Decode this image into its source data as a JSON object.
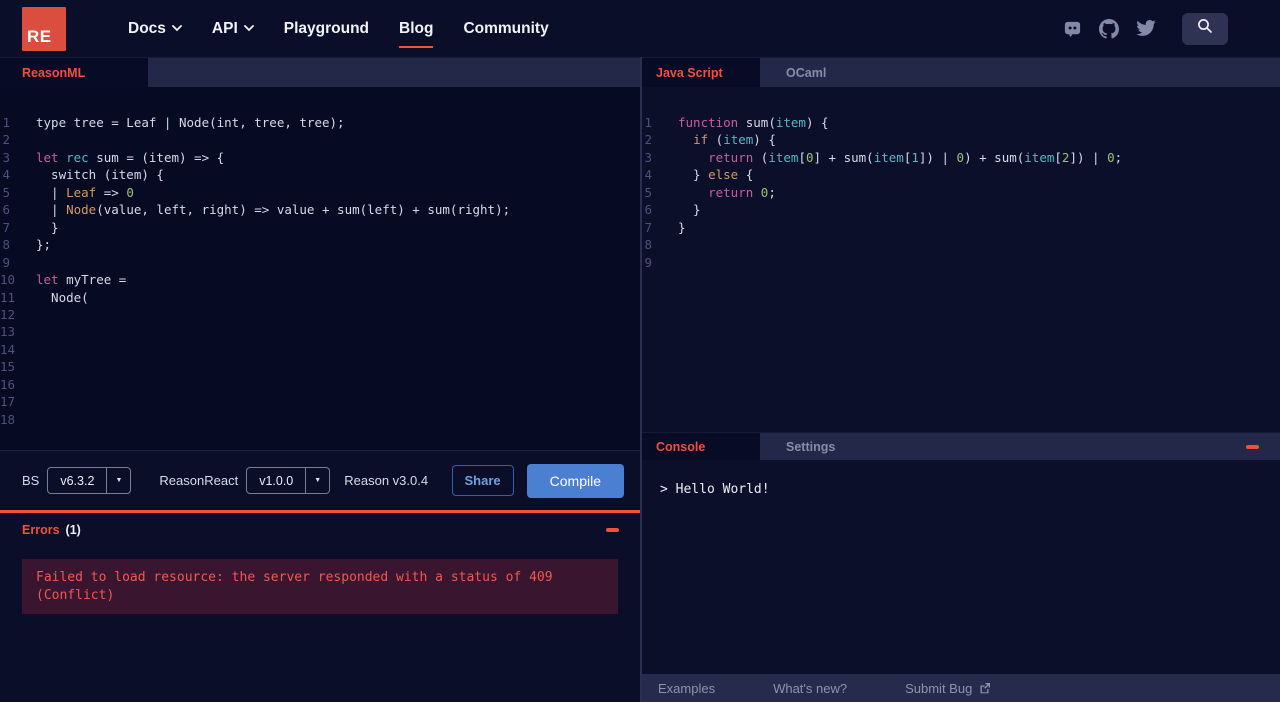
{
  "nav": {
    "logo_text": "RE",
    "items": [
      {
        "label": "Docs"
      },
      {
        "label": "API"
      },
      {
        "label": "Playground"
      },
      {
        "label": "Blog"
      },
      {
        "label": "Community"
      }
    ]
  },
  "left": {
    "tab_label": "ReasonML",
    "toolbar": {
      "bs_label": "BS",
      "bs_version": "v6.3.2",
      "reason_react_label": "ReasonReact",
      "reason_react_version": "v1.0.0",
      "reason_version_text": "Reason v3.0.4",
      "share_label": "Share",
      "compile_label": "Compile"
    },
    "errors": {
      "title": "Errors",
      "count": "(1)",
      "message": "Failed to load resource: the server responded with a status of 409 (Conflict)"
    }
  },
  "right": {
    "tab_active": "Java Script",
    "tab_inactive": "OCaml",
    "console_tab": "Console",
    "settings_tab": "Settings",
    "console_output": "> Hello World!",
    "footer_items": [
      {
        "label": "Examples"
      },
      {
        "label": "What's new?"
      },
      {
        "label": "Submit Bug"
      }
    ]
  },
  "reason_editor": {
    "lines": [
      [
        [
          "df",
          "type tree = Leaf | Node(int, tree, tree);"
        ]
      ],
      [],
      [
        [
          "kw",
          "let"
        ],
        [
          "df",
          " "
        ],
        [
          "cy",
          "rec"
        ],
        [
          "df",
          " sum = (item) => {"
        ]
      ],
      [
        [
          "df",
          "  switch (item) {"
        ]
      ],
      [
        [
          "df",
          "  | "
        ],
        [
          "or",
          "Leaf"
        ],
        [
          "df",
          " => "
        ],
        [
          "gr",
          "0"
        ]
      ],
      [
        [
          "df",
          "  | "
        ],
        [
          "or",
          "Node"
        ],
        [
          "df",
          "(value, left, right) => value + sum(left) + sum(right);"
        ]
      ],
      [
        [
          "df",
          "  }"
        ]
      ],
      [
        [
          "df",
          "};"
        ]
      ],
      [],
      [
        [
          "kw",
          "let"
        ],
        [
          "df",
          " myTree ="
        ]
      ],
      [
        [
          "df",
          "  Node("
        ]
      ],
      [],
      [],
      [],
      [],
      [],
      [],
      []
    ]
  },
  "js_editor": {
    "lines": [
      [
        [
          "kw",
          "function"
        ],
        [
          "df",
          " sum("
        ],
        [
          "cy",
          "item"
        ],
        [
          "df",
          ") {"
        ]
      ],
      [
        [
          "df",
          "  "
        ],
        [
          "or",
          "if"
        ],
        [
          "df",
          " ("
        ],
        [
          "cy",
          "item"
        ],
        [
          "df",
          ") {"
        ]
      ],
      [
        [
          "df",
          "    "
        ],
        [
          "kw",
          "return"
        ],
        [
          "df",
          " ("
        ],
        [
          "cy",
          "item"
        ],
        [
          "df",
          "["
        ],
        [
          "gr",
          "0"
        ],
        [
          "df",
          "] + sum("
        ],
        [
          "cy",
          "item"
        ],
        [
          "df",
          "["
        ],
        [
          "cy",
          "1"
        ],
        [
          "df",
          "]) | "
        ],
        [
          "gr",
          "0"
        ],
        [
          "df",
          ") + sum("
        ],
        [
          "cy",
          "item"
        ],
        [
          "df",
          "["
        ],
        [
          "gr",
          "2"
        ],
        [
          "df",
          "]) | "
        ],
        [
          "gr",
          "0"
        ],
        [
          "df",
          ";"
        ]
      ],
      [
        [
          "df",
          "  } "
        ],
        [
          "or",
          "else"
        ],
        [
          "df",
          " {"
        ]
      ],
      [
        [
          "df",
          "    "
        ],
        [
          "kw",
          "return"
        ],
        [
          "df",
          " "
        ],
        [
          "gr",
          "0"
        ],
        [
          "df",
          ";"
        ]
      ],
      [
        [
          "df",
          "  }"
        ]
      ],
      [
        [
          "df",
          "}"
        ]
      ],
      [],
      []
    ]
  },
  "colors": {
    "accent": "#f0503c",
    "logo_red": "#db4d3f",
    "compile_blue": "#4a7fd1",
    "error_text": "#ee5a4d",
    "error_bg": "#3a1530"
  }
}
